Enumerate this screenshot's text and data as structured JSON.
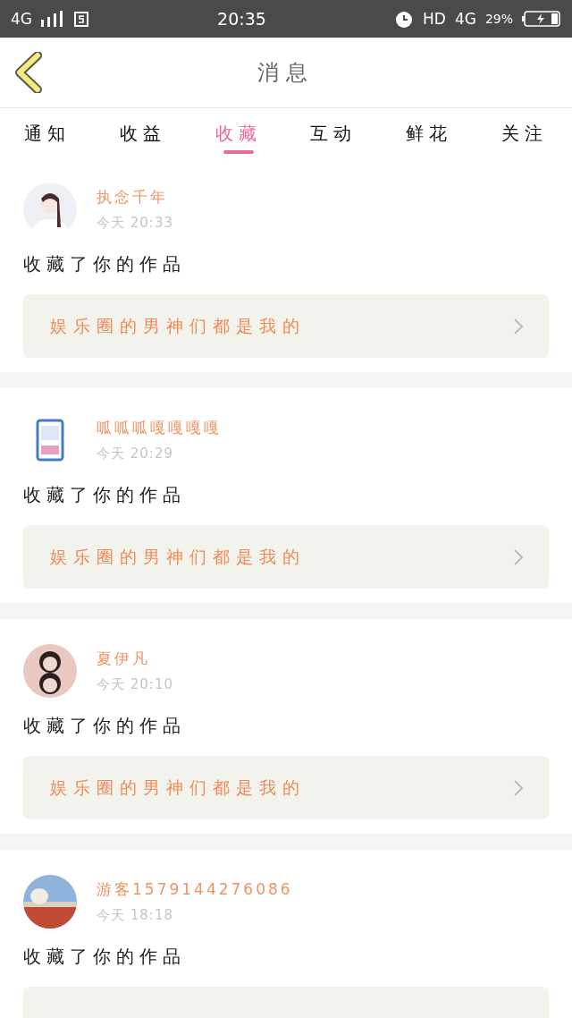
{
  "status_bar": {
    "network": "4G",
    "time": "20:35",
    "hd": "HD",
    "data": "4G",
    "battery": "29%"
  },
  "header": {
    "title": "消息"
  },
  "tabs": [
    {
      "label": "通知",
      "selected": false
    },
    {
      "label": "收益",
      "selected": false
    },
    {
      "label": "收藏",
      "selected": true
    },
    {
      "label": "互动",
      "selected": false
    },
    {
      "label": "鲜花",
      "selected": false
    },
    {
      "label": "关注",
      "selected": false
    }
  ],
  "messages": [
    {
      "name": "执念千年",
      "time": "今天 20:33",
      "action": "收藏了你的作品",
      "work": "娱乐圈的男神们都是我的"
    },
    {
      "name": "呱呱呱嘎嘎嘎嘎",
      "time": "今天 20:29",
      "action": "收藏了你的作品",
      "work": "娱乐圈的男神们都是我的"
    },
    {
      "name": "夏伊凡",
      "time": "今天 20:10",
      "action": "收藏了你的作品",
      "work": "娱乐圈的男神们都是我的"
    },
    {
      "name": "游客1579144276086",
      "time": "今天 18:18",
      "action": "收藏了你的作品"
    }
  ]
}
